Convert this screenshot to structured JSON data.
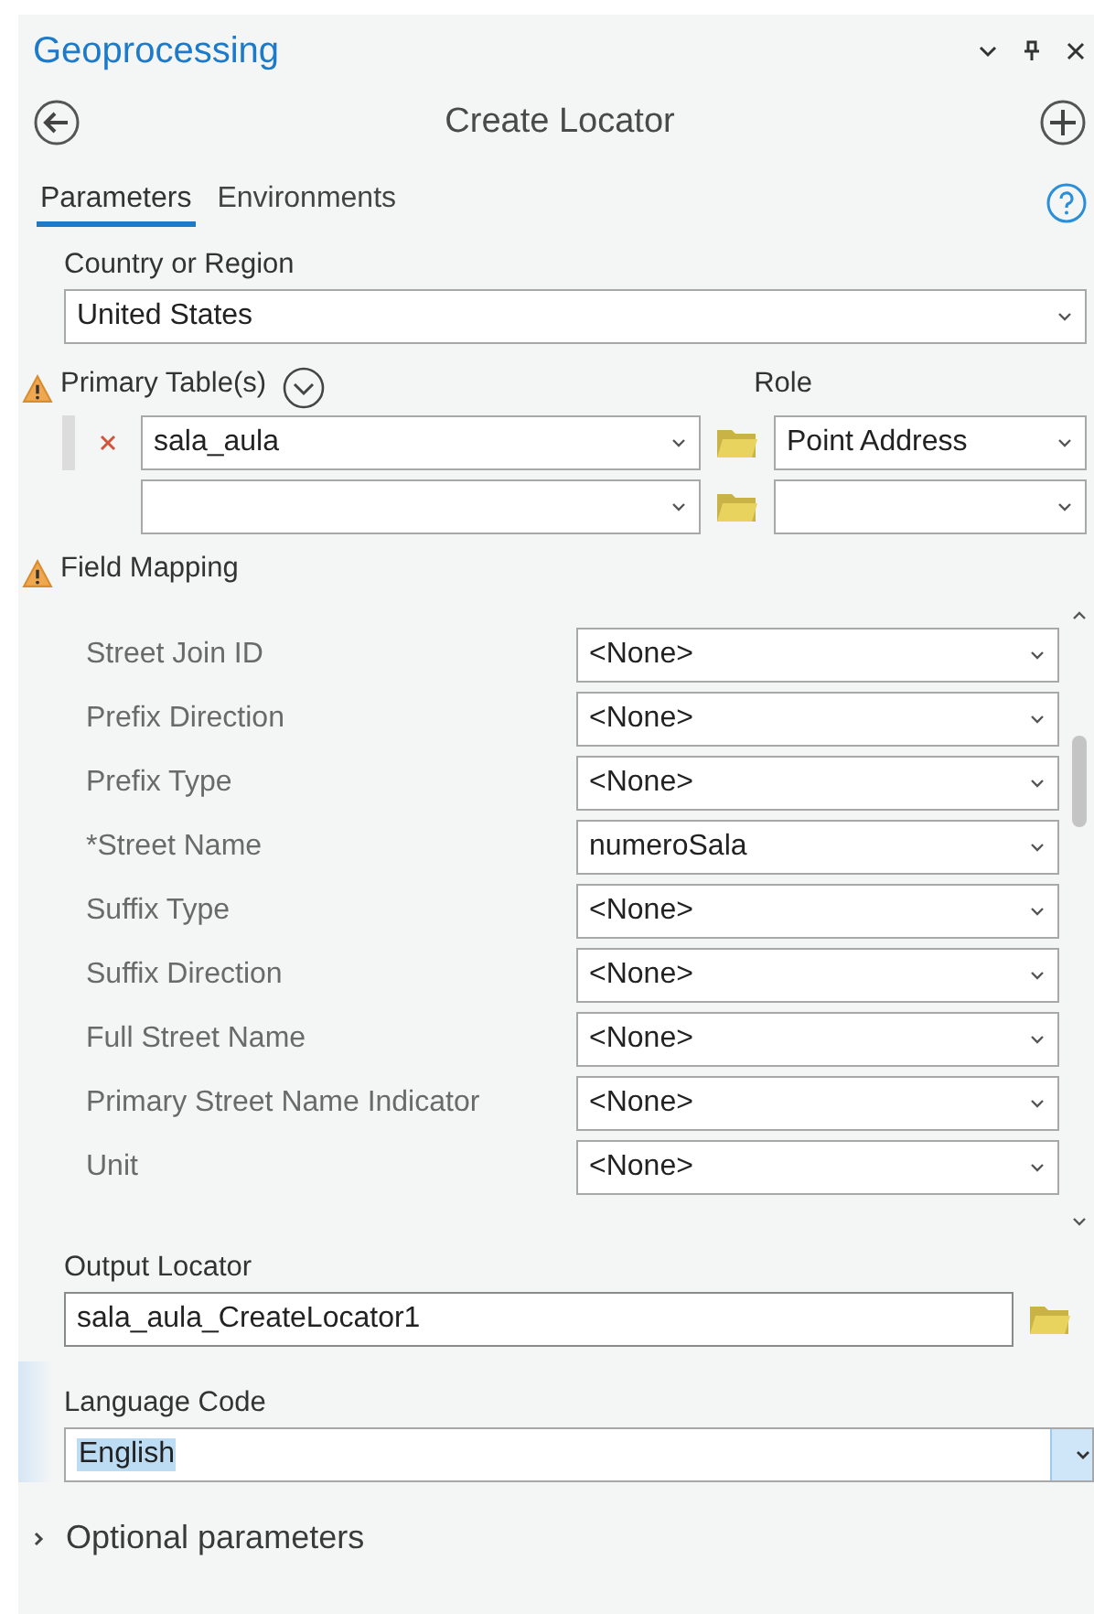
{
  "pane": {
    "title": "Geoprocessing"
  },
  "tool": {
    "title": "Create Locator"
  },
  "tabs": [
    {
      "label": "Parameters",
      "selected": true
    },
    {
      "label": "Environments",
      "selected": false
    }
  ],
  "country": {
    "label": "Country or Region",
    "value": "United States"
  },
  "primary_tables": {
    "label": "Primary Table(s)",
    "warning": true,
    "role_label": "Role",
    "rows": [
      {
        "value": "sala_aula",
        "role": "Point Address",
        "removable": true
      },
      {
        "value": "",
        "role": "",
        "removable": false
      }
    ]
  },
  "field_mapping": {
    "label": "Field Mapping",
    "warning": true,
    "rows": [
      {
        "field": "Street Join ID",
        "value": "<None>"
      },
      {
        "field": "Prefix Direction",
        "value": "<None>"
      },
      {
        "field": "Prefix Type",
        "value": "<None>"
      },
      {
        "field": "*Street Name",
        "value": "numeroSala"
      },
      {
        "field": "Suffix Type",
        "value": "<None>"
      },
      {
        "field": "Suffix Direction",
        "value": "<None>"
      },
      {
        "field": "Full Street Name",
        "value": "<None>"
      },
      {
        "field": "Primary Street Name Indicator",
        "value": "<None>"
      },
      {
        "field": "Unit",
        "value": "<None>"
      }
    ]
  },
  "output_locator": {
    "label": "Output Locator",
    "value": "sala_aula_CreateLocator1"
  },
  "language_code": {
    "label": "Language Code",
    "value": "English",
    "selected": true
  },
  "optional_parameters": {
    "label": "Optional parameters",
    "expanded": false
  }
}
